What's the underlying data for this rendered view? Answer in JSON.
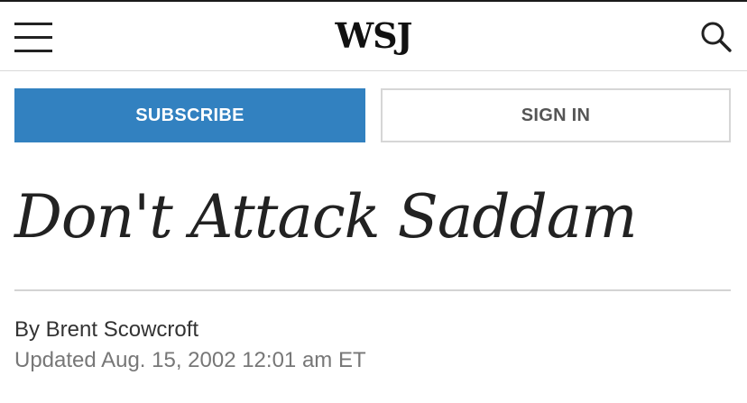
{
  "header": {
    "logo": "WSJ",
    "menu_icon": "hamburger-menu-icon",
    "search_icon": "search-icon"
  },
  "actions": {
    "subscribe_label": "SUBSCRIBE",
    "signin_label": "SIGN IN"
  },
  "article": {
    "headline": "Don't Attack Saddam",
    "byline": "By Brent Scowcroft",
    "updated": "Updated Aug. 15, 2002 12:01 am ET"
  },
  "colors": {
    "accent": "#3281c0",
    "text": "#222222",
    "muted": "#777777",
    "border": "#d6d6d6"
  }
}
